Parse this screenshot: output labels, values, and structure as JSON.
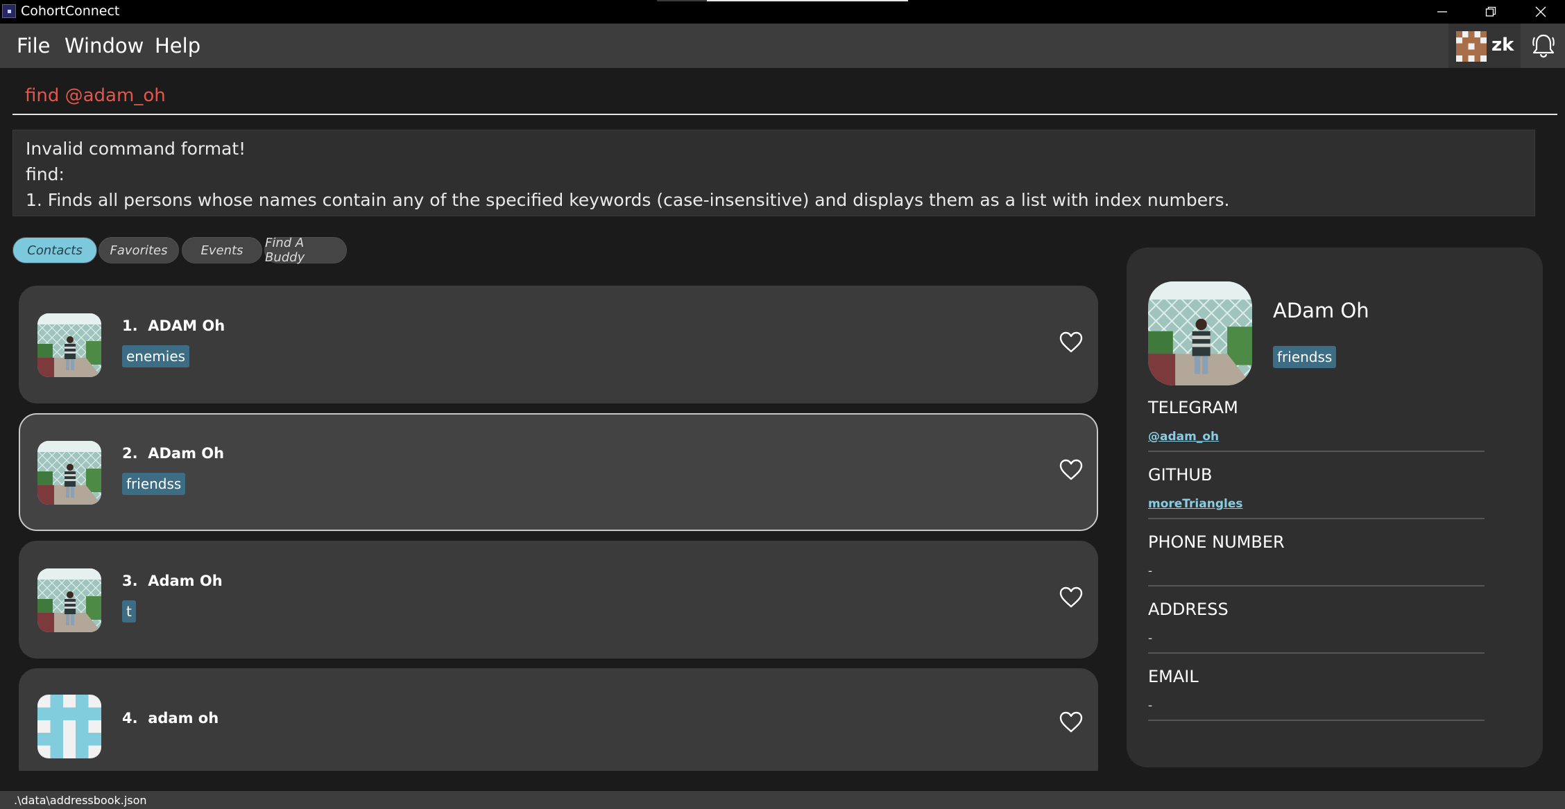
{
  "window": {
    "title": "CohortConnect",
    "controls": [
      "minimize-icon",
      "restore-icon",
      "close-icon"
    ]
  },
  "menu": {
    "items": [
      "File",
      "Window",
      "Help"
    ]
  },
  "user": {
    "name": "zk",
    "avatar_icon": "pixel-avatar-icon",
    "notification_icon": "bell-icon"
  },
  "command": {
    "value": "find @adam_oh"
  },
  "result": {
    "lines": [
      "Invalid command format!",
      "find:",
      "1. Finds all persons whose names contain any of the specified keywords (case-insensitive) and displays them as a list with index numbers."
    ]
  },
  "tabs": [
    {
      "label": "Contacts",
      "active": true
    },
    {
      "label": "Favorites",
      "active": false
    },
    {
      "label": "Events",
      "active": false
    },
    {
      "label": "Find A Buddy",
      "active": false
    }
  ],
  "contacts": [
    {
      "index": "1.",
      "name": "ADAM Oh",
      "tag": "enemies",
      "avatar": "photo"
    },
    {
      "index": "2.",
      "name": "ADam Oh",
      "tag": "friendss",
      "avatar": "photo",
      "selected": true
    },
    {
      "index": "3.",
      "name": "Adam Oh",
      "tag": "t",
      "avatar": "photo"
    },
    {
      "index": "4.",
      "name": "adam oh",
      "tag": "",
      "avatar": "default-identicon"
    }
  ],
  "detail": {
    "name": "ADam Oh",
    "tag": "friendss",
    "fields": [
      {
        "label": "TELEGRAM",
        "value": "@adam_oh",
        "link": true
      },
      {
        "label": "GITHUB",
        "value": "moreTriangles",
        "link": true
      },
      {
        "label": "PHONE NUMBER",
        "value": "-",
        "link": false
      },
      {
        "label": "ADDRESS",
        "value": "-",
        "link": false
      },
      {
        "label": "EMAIL",
        "value": "-",
        "link": false
      }
    ]
  },
  "status": {
    "path": ".\\data\\addressbook.json"
  },
  "colors": {
    "accent": "#7cc9de",
    "tag_bg": "#3c6d84",
    "command_text": "#e2574c",
    "link": "#87cde4"
  }
}
